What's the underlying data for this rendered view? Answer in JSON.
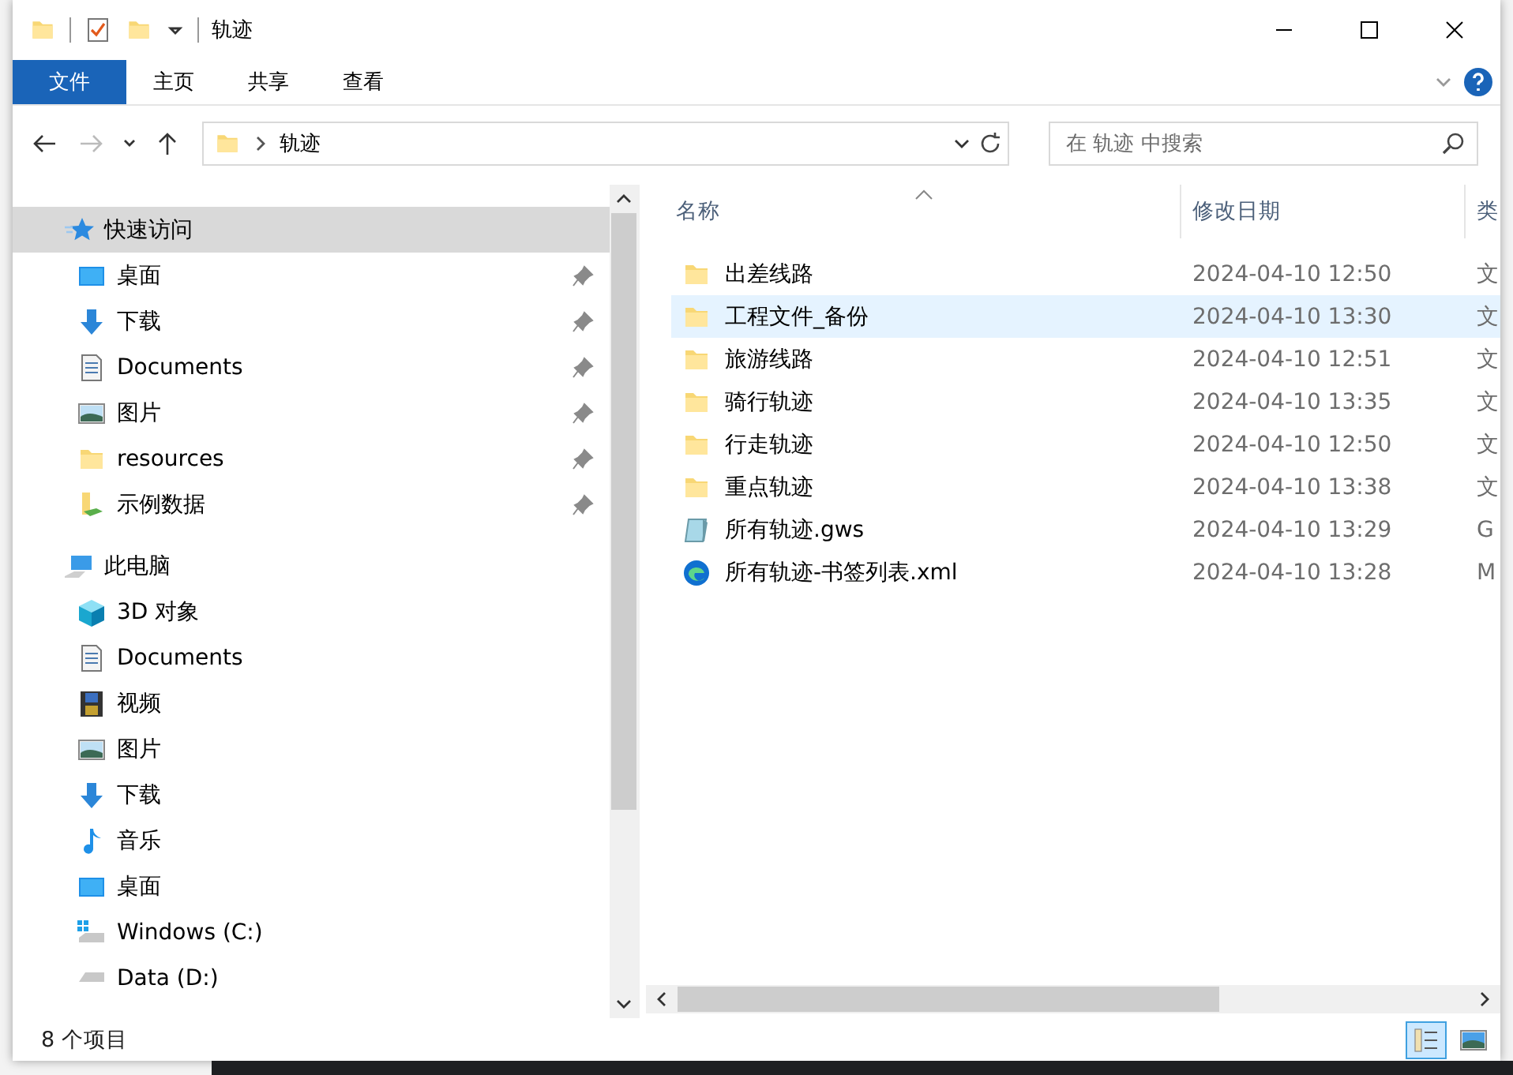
{
  "window": {
    "title": "轨迹"
  },
  "ribbon": {
    "tabs": [
      {
        "label": "文件",
        "kind": "file-menu"
      },
      {
        "label": "主页",
        "kind": "tab"
      },
      {
        "label": "共享",
        "kind": "tab"
      },
      {
        "label": "查看",
        "kind": "tab"
      }
    ]
  },
  "address": {
    "path": "轨迹",
    "search_placeholder": "在 轨迹 中搜索"
  },
  "navigation": [
    {
      "label": "快速访问",
      "kind": "star",
      "selected": true,
      "children": [
        {
          "label": "桌面",
          "kind": "desktop",
          "pinned": true
        },
        {
          "label": "下载",
          "kind": "download",
          "pinned": true
        },
        {
          "label": "Documents",
          "kind": "document",
          "pinned": true
        },
        {
          "label": "图片",
          "kind": "pictures",
          "pinned": true
        },
        {
          "label": "resources",
          "kind": "folder",
          "pinned": true
        },
        {
          "label": "示例数据",
          "kind": "folder-sync",
          "pinned": true
        }
      ]
    },
    {
      "label": "此电脑",
      "kind": "pc",
      "selected": false,
      "children": [
        {
          "label": "3D 对象",
          "kind": "cube",
          "pinned": false
        },
        {
          "label": "Documents",
          "kind": "document",
          "pinned": false
        },
        {
          "label": "视频",
          "kind": "video",
          "pinned": false
        },
        {
          "label": "图片",
          "kind": "pictures",
          "pinned": false
        },
        {
          "label": "下载",
          "kind": "download",
          "pinned": false
        },
        {
          "label": "音乐",
          "kind": "music",
          "pinned": false
        },
        {
          "label": "桌面",
          "kind": "desktop",
          "pinned": false
        },
        {
          "label": "Windows (C:)",
          "kind": "drive-windows",
          "pinned": false
        },
        {
          "label": "Data (D:)",
          "kind": "drive",
          "pinned": false
        }
      ]
    }
  ],
  "table": {
    "columns": [
      "名称",
      "修改日期",
      "类"
    ],
    "rows": [
      {
        "name": "出差线路",
        "date": "2024-04-10 12:50",
        "column_3": "文",
        "kind": "folder",
        "selected": false
      },
      {
        "name": "工程文件_备份",
        "date": "2024-04-10 13:30",
        "column_3": "文",
        "kind": "folder",
        "selected": true
      },
      {
        "name": "旅游线路",
        "date": "2024-04-10 12:51",
        "column_3": "文",
        "kind": "folder",
        "selected": false
      },
      {
        "name": "骑行轨迹",
        "date": "2024-04-10 13:35",
        "column_3": "文",
        "kind": "folder",
        "selected": false
      },
      {
        "name": "行走轨迹",
        "date": "2024-04-10 12:50",
        "column_3": "文",
        "kind": "folder",
        "selected": false
      },
      {
        "name": "重点轨迹",
        "date": "2024-04-10 13:38",
        "column_3": "文",
        "kind": "folder",
        "selected": false
      },
      {
        "name": "所有轨迹.gws",
        "date": "2024-04-10 13:29",
        "column_3": "G",
        "kind": "gws",
        "selected": false
      },
      {
        "name": "所有轨迹-书签列表.xml",
        "date": "2024-04-10 13:28",
        "column_3": "M",
        "kind": "edge",
        "selected": false
      }
    ]
  },
  "status_bar": {
    "count": "8 个项目",
    "views": [
      {
        "kind": "details",
        "selected": true
      },
      {
        "kind": "large-icons",
        "selected": false
      }
    ]
  }
}
